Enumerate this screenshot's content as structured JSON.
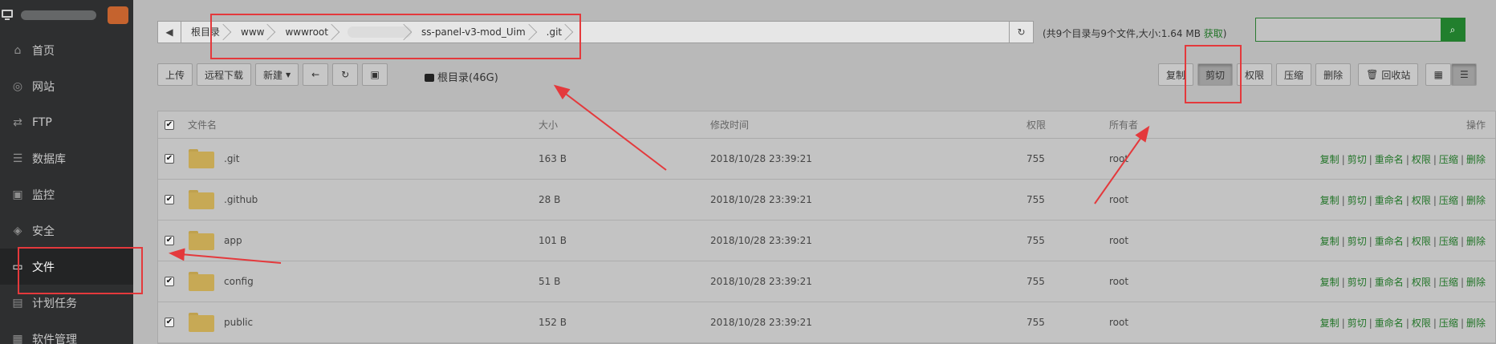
{
  "sidebar": {
    "nav": [
      {
        "label": "首页",
        "icon": "home-icon"
      },
      {
        "label": "网站",
        "icon": "globe-icon"
      },
      {
        "label": "FTP",
        "icon": "ftp-icon"
      },
      {
        "label": "数据库",
        "icon": "database-icon"
      },
      {
        "label": "监控",
        "icon": "monitor-icon"
      },
      {
        "label": "安全",
        "icon": "shield-icon"
      },
      {
        "label": "文件",
        "icon": "folder-icon"
      },
      {
        "label": "计划任务",
        "icon": "calendar-icon"
      },
      {
        "label": "软件管理",
        "icon": "app-icon"
      }
    ]
  },
  "path": {
    "crumbs": [
      "根目录",
      "www",
      "wwwroot",
      "ss-panel-v3-mod_Uim",
      ".git"
    ],
    "dir_info": "(共9个目录与9个文件,大小:1.64 MB ",
    "dir_info_link": "获取",
    "dir_info_end": ")"
  },
  "search": {
    "placeholder": ""
  },
  "toolbar_left": {
    "upload": "上传",
    "remote_download": "远程下载",
    "new": "新建",
    "root_label": "根目录(46G)"
  },
  "toolbar_right": {
    "copy": "复制",
    "cut": "剪切",
    "permission": "权限",
    "compress": "压缩",
    "delete": "删除",
    "recycle": "回收站"
  },
  "table": {
    "headers": {
      "name": "文件名",
      "size": "大小",
      "mtime": "修改时间",
      "perm": "权限",
      "owner": "所有者",
      "ops": "操作"
    },
    "rows": [
      {
        "name": ".git",
        "size": "163 B",
        "mtime": "2018/10/28 23:39:21",
        "perm": "755",
        "owner": "root"
      },
      {
        "name": ".github",
        "size": "28 B",
        "mtime": "2018/10/28 23:39:21",
        "perm": "755",
        "owner": "root"
      },
      {
        "name": "app",
        "size": "101 B",
        "mtime": "2018/10/28 23:39:21",
        "perm": "755",
        "owner": "root"
      },
      {
        "name": "config",
        "size": "51 B",
        "mtime": "2018/10/28 23:39:21",
        "perm": "755",
        "owner": "root"
      },
      {
        "name": "public",
        "size": "152 B",
        "mtime": "2018/10/28 23:39:21",
        "perm": "755",
        "owner": "root"
      }
    ],
    "row_ops": [
      "复制",
      "剪切",
      "重命名",
      "权限",
      "压缩",
      "删除"
    ],
    "checked_mark": "✔"
  },
  "colors": {
    "accent_green": "#217427",
    "annotation_red": "#e4393c",
    "sidebar_bg": "#2e2f30"
  }
}
